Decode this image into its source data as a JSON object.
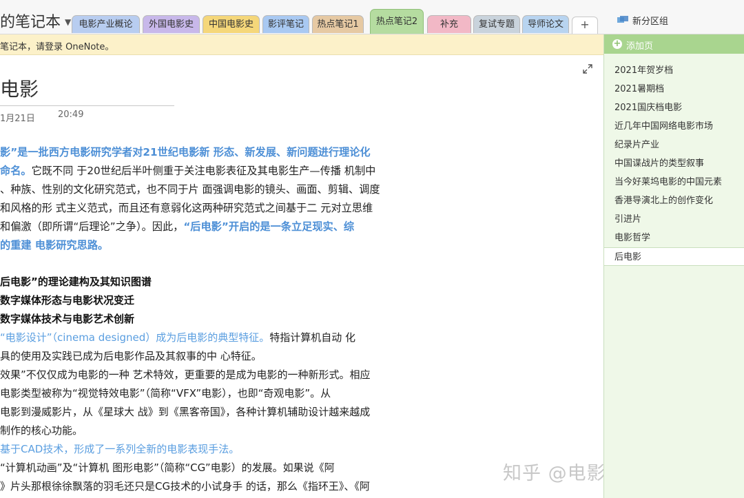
{
  "notebook": {
    "title": "的笔记本"
  },
  "tabs": [
    {
      "label": "电影产业概论",
      "color": "#b8cdf0"
    },
    {
      "label": "外国电影史",
      "color": "#c8b8ea"
    },
    {
      "label": "中国电影史",
      "color": "#f5d77a"
    },
    {
      "label": "影评笔记",
      "color": "#a9c9f2"
    },
    {
      "label": "热点笔记1",
      "color": "#e6c9a3"
    },
    {
      "label": "热点笔记2",
      "color": "#b5dca0"
    },
    {
      "label": "补充",
      "color": "#f2b8c6"
    },
    {
      "label": "复试专题",
      "color": "#c9d3dc"
    },
    {
      "label": "导师论文",
      "color": "#b8d4f0"
    }
  ],
  "tab_add_label": "+",
  "section_group": "新分区组",
  "infobar": {
    "text": "笔记本，请登录 OneNote。"
  },
  "page": {
    "title": "电影",
    "date": "1月21日",
    "time": "20:49"
  },
  "paragraph": [
    [
      {
        "t": "影”是一批西方电影研究学者对21世纪电影新 形态、新发展、新问题进行理论化",
        "c": "hl"
      }
    ],
    [
      {
        "t": "命名。",
        "c": "hl"
      },
      {
        "t": "它既不同 于20世纪后半叶侧重于关注电影表征及其电影生产—传播 机制中",
        "c": ""
      }
    ],
    [
      {
        "t": "、种族、性别的文化研究范式，也不同于片 面强调电影的镜头、画面、剪辑、调度",
        "c": ""
      }
    ],
    [
      {
        "t": "和风格的形 式主义范式，而且还有意弱化这两种研究范式之间基于二 元对立思维",
        "c": ""
      }
    ],
    [
      {
        "t": "和偏激（即所谓“后理论”之争）。因此，",
        "c": ""
      },
      {
        "t": "“后电影”开启的是一条立足现实、综",
        "c": "hl"
      }
    ],
    [
      {
        "t": "的重建 电影研究思路。",
        "c": "hl"
      }
    ]
  ],
  "list": [
    [
      {
        "t": "后电影”的理论建构及其知识图谱",
        "c": "bold"
      }
    ],
    [
      {
        "t": "数字媒体形态与电影状况变迁",
        "c": "bold"
      }
    ],
    [
      {
        "t": "数字媒体技术与电影艺术创新",
        "c": "bold"
      }
    ],
    [
      {
        "t": "“电影设计”（cinema designed）成为后电影的典型特征。",
        "c": "hl2"
      },
      {
        "t": "特指计算机自动 化",
        "c": ""
      }
    ],
    [
      {
        "t": "具的使用及实践已成为后电影作品及其叙事的中 心特征。",
        "c": ""
      }
    ],
    [
      {
        "t": "效果”不仅仅成为电影的一种 艺术特效，更重要的是成为电影的一种新形式。相应",
        "c": ""
      }
    ],
    [
      {
        "t": "电影类型被称为“视觉特效电影”（简称“VFX”电影），也即“奇观电影”。从",
        "c": ""
      }
    ],
    [
      {
        "t": "电影到漫威影片，从《星球大 战》到《黑客帝国》，各种计算机辅助设计越来越成",
        "c": ""
      }
    ],
    [
      {
        "t": "制作的核心功能。",
        "c": ""
      }
    ],
    [
      {
        "t": "基于CAD技术，形成了一系列全新的电影表现手法。",
        "c": "hl2"
      }
    ],
    [
      {
        "t": "“计算机动画”及“计算机 图形电影”（简称“CG”电影）的发展。如果说《阿",
        "c": ""
      }
    ],
    [
      {
        "t": "》片头那根徐徐飘落的羽毛还只是CG技术的小试身手 的话，那么《指环王》、《阿",
        "c": ""
      }
    ]
  ],
  "sidebar": {
    "add_page_label": "添加页",
    "pages": [
      "2021年贺岁档",
      "2021暑期档",
      "2021国庆档电影",
      "近几年中国网络电影市场",
      "纪录片产业",
      "中国谍战片的类型叙事",
      "当今好莱坞电影的中国元素",
      "香港导演北上的创作变化",
      "引进片",
      "电影哲学",
      "后电影"
    ],
    "selected_index": 10
  },
  "watermark": "知乎 @电影学考研阁楼"
}
